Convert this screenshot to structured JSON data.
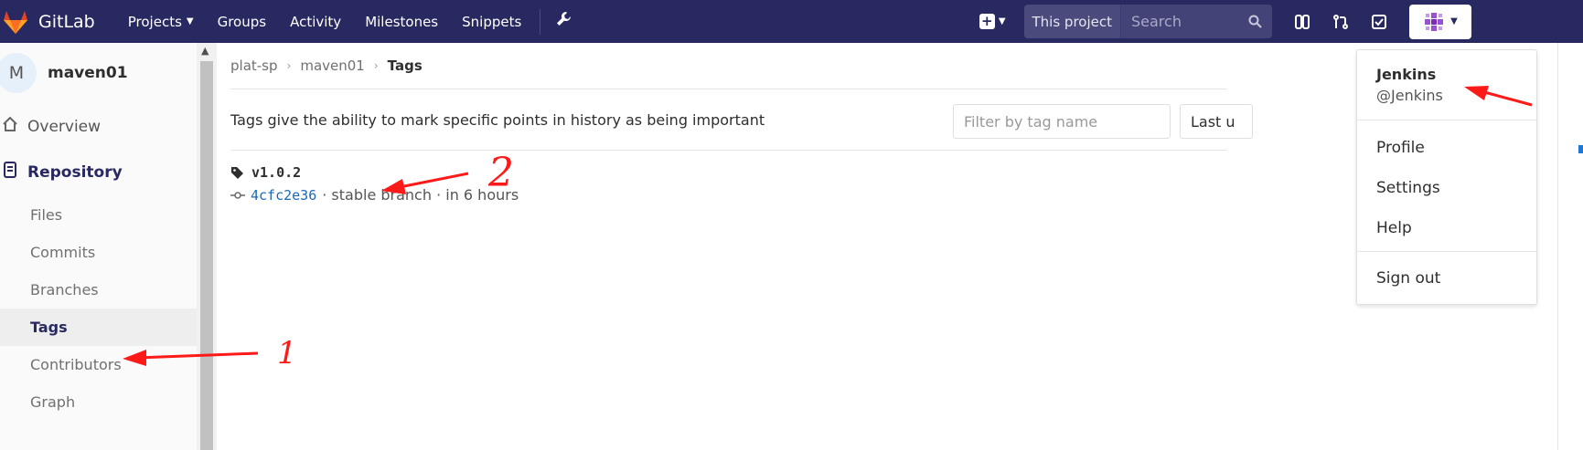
{
  "header": {
    "brand": "GitLab",
    "nav": [
      {
        "label": "Projects",
        "has_dropdown": true
      },
      {
        "label": "Groups"
      },
      {
        "label": "Activity"
      },
      {
        "label": "Milestones"
      },
      {
        "label": "Snippets"
      }
    ],
    "admin_icon": "wrench-icon",
    "search_scope": "This project",
    "search_placeholder": "Search",
    "colors": {
      "bar": "#292961",
      "accent": "#1f78d1"
    }
  },
  "sidebar": {
    "project_initial": "M",
    "project_name": "maven01",
    "overview": "Overview",
    "repository": "Repository",
    "sub_items": [
      "Files",
      "Commits",
      "Branches",
      "Tags",
      "Contributors",
      "Graph"
    ],
    "active_sub": "Tags"
  },
  "breadcrumb": {
    "group": "plat-sp",
    "project": "maven01",
    "current": "Tags"
  },
  "main": {
    "description": "Tags give the ability to mark specific points in history as being important",
    "filter_placeholder": "Filter by tag name",
    "sort_label": "Last u",
    "tag": {
      "name": "v1.0.2",
      "sha": "4cfc2e36",
      "meta": "· stable branch · in 6 hours"
    }
  },
  "user_menu": {
    "name": "Jenkins",
    "handle": "@Jenkins",
    "items": [
      "Profile",
      "Settings",
      "Help"
    ],
    "sign_out": "Sign out"
  },
  "annotations": {
    "label_1": "1",
    "label_2": "2",
    "color": "#ff1a1a"
  }
}
